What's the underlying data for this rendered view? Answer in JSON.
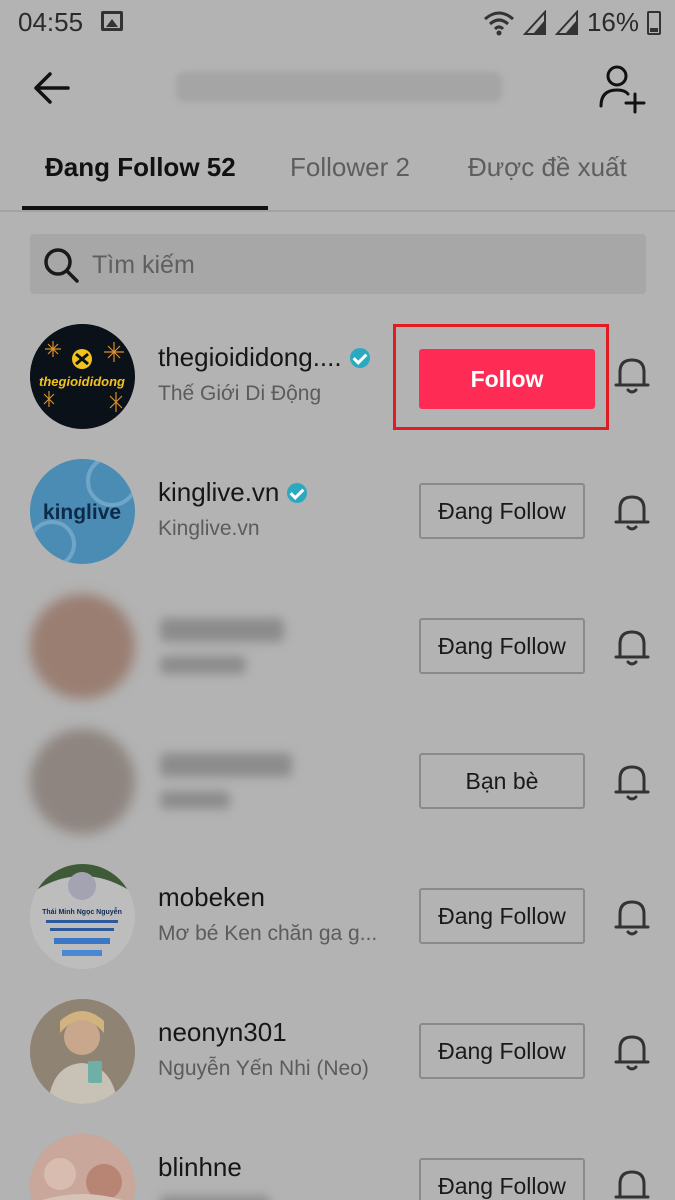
{
  "status_bar": {
    "time": "04:55",
    "battery_percent": "16%"
  },
  "header": {
    "title_blurred": ""
  },
  "tabs": [
    {
      "label": "Đang Follow 52",
      "active": true
    },
    {
      "label": "Follower 2",
      "active": false
    },
    {
      "label": "Được đề xuất",
      "active": false
    }
  ],
  "search": {
    "placeholder": "Tìm kiếm"
  },
  "rows": [
    {
      "username": "thegioididong....",
      "verified": true,
      "display_name": "Thế Giới Di Động",
      "button": "Follow",
      "avatar_text": "thegioididong"
    },
    {
      "username": "kinglive.vn",
      "verified": true,
      "display_name": "Kinglive.vn",
      "button": "Đang Follow",
      "avatar_text": "kinglive"
    },
    {
      "username": "",
      "verified": false,
      "display_name": "",
      "button": "Đang Follow"
    },
    {
      "username": "",
      "verified": false,
      "display_name": "",
      "button": "Bạn bè"
    },
    {
      "username": "mobeken",
      "verified": false,
      "display_name": "Mơ bé Ken chăn ga g...",
      "button": "Đang Follow",
      "avatar_text": "Thái Minh Ngọc Nguyễn"
    },
    {
      "username": "neonyn301",
      "verified": false,
      "display_name": "Nguyễn Yến Nhi (Neo)",
      "button": "Đang Follow"
    },
    {
      "username": "blinhne",
      "verified": false,
      "display_name": "",
      "button": "Đang Follow"
    }
  ],
  "colors": {
    "follow_accent": "#fe2c55",
    "highlight_border": "#e11b22",
    "verified": "#2aa9c0"
  }
}
